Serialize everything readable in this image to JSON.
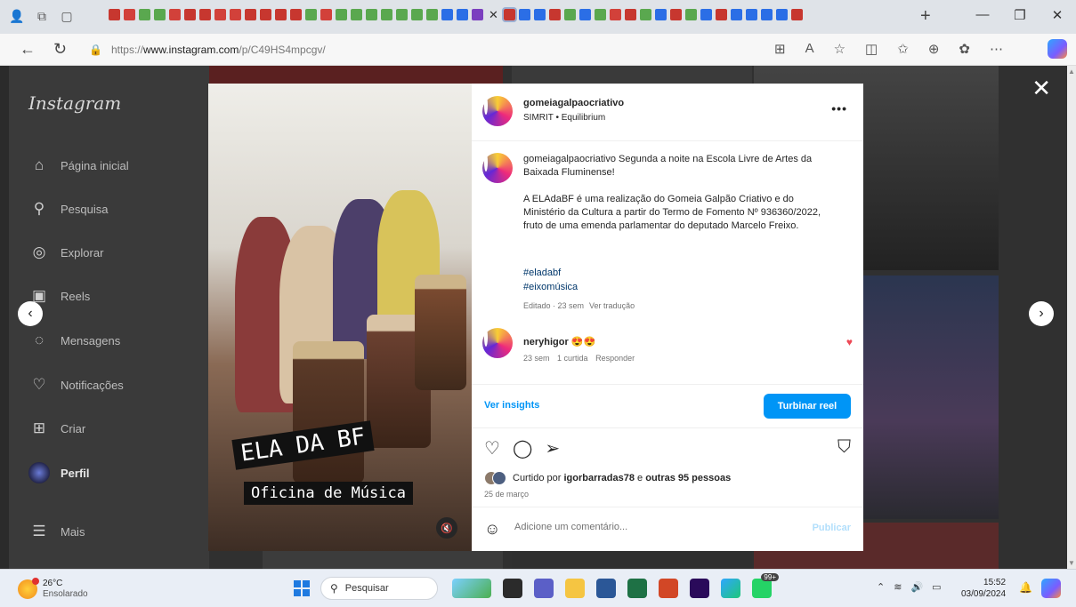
{
  "browser": {
    "url_prefix": "https://",
    "url_host": "www.instagram.com",
    "url_path": "/p/C49HS4mpcgv/",
    "tab_favicon_colors": [
      "#c7372f",
      "#d2413a",
      "#5aa84f",
      "#5aa84f",
      "#d2413a",
      "#c7372f",
      "#c7372f",
      "#d2413a",
      "#d2413a",
      "#c7372f",
      "#c7372f",
      "#c7372f",
      "#c7372f",
      "#5aa84f",
      "#d2413a",
      "#5aa84f",
      "#5aa84f",
      "#5aa84f",
      "#5aa84f",
      "#5aa84f",
      "#5aa84f",
      "#5aa84f",
      "#2b6ee6",
      "#2b6ee6",
      "#7b3fbf"
    ],
    "tab_favicon_colors_after": [
      "#c7372f",
      "#2b6ee6",
      "#2b6ee6",
      "#c7372f",
      "#5aa84f",
      "#2b6ee6",
      "#5aa84f",
      "#d2413a",
      "#c7372f",
      "#5aa84f",
      "#2b6ee6",
      "#c7372f",
      "#5aa84f",
      "#2b6ee6",
      "#c7372f",
      "#2b6ee6",
      "#2b6ee6",
      "#2b6ee6",
      "#2b6ee6",
      "#c7372f"
    ]
  },
  "instagram": {
    "logo": "Instagram",
    "nav": [
      {
        "label": "Página inicial",
        "icon": "home-icon"
      },
      {
        "label": "Pesquisa",
        "icon": "search-icon"
      },
      {
        "label": "Explorar",
        "icon": "compass-icon"
      },
      {
        "label": "Reels",
        "icon": "reels-icon"
      },
      {
        "label": "Mensagens",
        "icon": "messenger-icon"
      },
      {
        "label": "Notificações",
        "icon": "heart-icon"
      },
      {
        "label": "Criar",
        "icon": "plus-square-icon"
      },
      {
        "label": "Perfil",
        "icon": "profile-avatar"
      },
      {
        "label": "Mais",
        "icon": "menu-icon"
      }
    ],
    "close_symbol": "✕"
  },
  "post": {
    "media": {
      "overlay_title": "ELA DA BF",
      "overlay_subtitle": "Oficina de Música"
    },
    "author": "gomeiagalpaocriativo",
    "audio": "SIMRIT • Equilibrium",
    "caption": {
      "username": "gomeiagalpaocriativo",
      "line1": "Segunda a noite na Escola Livre de Artes da Baixada Fluminense!",
      "line2": "A ELAdaBF é uma realização do Gomeia Galpão Criativo e do Ministério da Cultura a partir do Termo de Fomento Nº 936360/2022, fruto de uma emenda parlamentar do deputado Marcelo Freixo.",
      "hashtags": [
        "#eladabf",
        "#eixomúsica"
      ],
      "edited": "Editado · 23 sem",
      "translate": "Ver tradução"
    },
    "comment": {
      "username": "neryhigor",
      "text": "😍😍",
      "time": "23 sem",
      "likes": "1 curtida",
      "reply": "Responder"
    },
    "insights_label": "Ver insights",
    "boost_label": "Turbinar reel",
    "likes_text_prefix": "Curtido por",
    "likes_user": "igorbarradas78",
    "likes_text_mid": "e",
    "likes_others": "outras 95 pessoas",
    "date": "25 de março",
    "comment_placeholder": "Adicione um comentário...",
    "publish_label": "Publicar"
  },
  "taskbar": {
    "temperature": "26°C",
    "weather_desc": "Ensolarado",
    "search_label": "Pesquisar",
    "time": "15:52",
    "date": "03/09/2024",
    "badge": "99+"
  }
}
